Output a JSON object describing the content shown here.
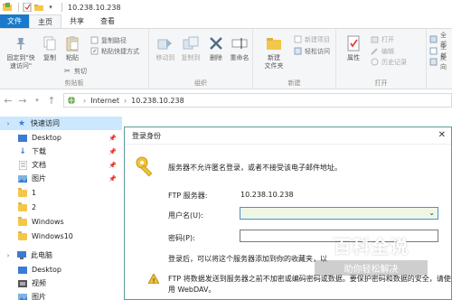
{
  "titlebar": {
    "path": "10.238.10.238",
    "quick_access_icons": [
      "properties-icon",
      "new-folder-icon",
      "qa-dropdown-icon"
    ]
  },
  "ribbon_tabs": {
    "file": "文件",
    "home": "主页",
    "share": "共享",
    "view": "查看"
  },
  "ribbon": {
    "clipboard": {
      "label": "剪贴板",
      "pin": "固定到\"快\n速访问\"",
      "copy": "复制",
      "paste": "粘贴",
      "copy_path": "复制路径",
      "paste_shortcut": "粘贴快捷方式",
      "cut": "剪切"
    },
    "organize": {
      "label": "组织",
      "move_to": "移动到",
      "copy_to": "复制到",
      "delete": "删除",
      "rename": "重命名"
    },
    "new": {
      "label": "新建",
      "new_folder": "新建\n文件夹",
      "new_item": "新建项目",
      "easy_access": "轻松访问"
    },
    "open": {
      "label": "打开",
      "properties": "属性",
      "open": "打开",
      "edit": "编辑",
      "history": "历史记录"
    },
    "select": {
      "select_all": "全部",
      "select_none": "全部",
      "invert": "反向"
    }
  },
  "address": {
    "crumbs": [
      "Internet",
      "10.238.10.238"
    ]
  },
  "nav": {
    "quick_access": "快速访问",
    "items": [
      {
        "label": "Desktop",
        "pinned": true
      },
      {
        "label": "下载",
        "pinned": true
      },
      {
        "label": "文档",
        "pinned": true
      },
      {
        "label": "图片",
        "pinned": true
      },
      {
        "label": "1",
        "pinned": false
      },
      {
        "label": "2",
        "pinned": false
      },
      {
        "label": "Windows",
        "pinned": false
      },
      {
        "label": "Windows10",
        "pinned": false
      }
    ],
    "this_pc": "此电脑",
    "pc_items": [
      "Desktop",
      "视频",
      "图片"
    ]
  },
  "dialog": {
    "title": "登录身份",
    "message": "服务器不允许匿名登录，或者不接受该电子邮件地址。",
    "ftp_server_label": "FTP 服务器:",
    "ftp_server_value": "10.238.10.238",
    "username_label": "用户名(U):",
    "username_value": "",
    "password_label": "密码(P):",
    "password_value": "",
    "note": "登录后，可以将这个服务器添加到你的收藏夹，以",
    "warning_line1": "FTP 将数据发送到服务器之前不加密或编码密码或数据。要保护密码和数据的安全，请使",
    "warning_line2": "用 WebDAV。"
  },
  "watermark": {
    "main": "百科全说",
    "sub": "助你轻松解决"
  },
  "colors": {
    "file_tab": "#1979ca",
    "selection": "#cce8ff",
    "dialog_border": "#5a9c96",
    "folder": "#f3c74c"
  }
}
